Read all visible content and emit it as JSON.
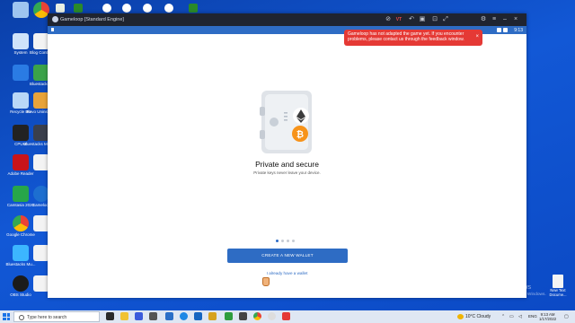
{
  "desktop": {
    "left_column": [
      {
        "label": ""
      },
      {
        "label": ""
      },
      {
        "label": "System"
      },
      {
        "label": ""
      },
      {
        "label": "Recycle Bin"
      },
      {
        "label": "Ultra Adware Killer"
      },
      {
        "label": "CPU-Z"
      },
      {
        "label": "Adobe Reader"
      },
      {
        "label": "Camtasia 2020"
      },
      {
        "label": "Google Chrome"
      },
      {
        "label": "Bluestacks Mu..."
      },
      {
        "label": "OBS Studio"
      }
    ],
    "right_column": [
      {
        "label": ""
      },
      {
        "label": ""
      },
      {
        "label": "Blog Content"
      },
      {
        "label": "Bluestacks X"
      },
      {
        "label": "Revo Uninstaller"
      },
      {
        "label": "Bluestacks Multi-Instance"
      },
      {
        "label": ""
      },
      {
        "label": "Gameloop"
      },
      {
        "label": ""
      },
      {
        "label": ""
      },
      {
        "label": ""
      },
      {
        "label": ""
      }
    ],
    "right_icon": {
      "label": "New Text Docume..."
    }
  },
  "window": {
    "title": "Gameloop [Standard Engine]",
    "status_time": "9:13"
  },
  "toast": {
    "message": "Gameloop has not adapted the game yet. If you encounter problems, please contact us through the feedback window.",
    "close": "×"
  },
  "onboarding": {
    "headline": "Private and secure",
    "subline": "Private keys never leave your device.",
    "primary_button": "CREATE A NEW WALLET",
    "secondary_link": "I already have a wallet",
    "page_count": 4,
    "active_page": 0
  },
  "watermark": {
    "line1": "Activate Windows",
    "line2": "Go to Settings to activate Windows."
  },
  "taskbar": {
    "search_placeholder": "Type here to search",
    "weather": "10°C  Cloudy",
    "language": "ENG",
    "time": "9:13 AM",
    "date": "1/17/2022"
  },
  "colors": {
    "accent": "#2e6cc4",
    "toast": "#e53935",
    "bitcoin": "#f7931a"
  }
}
